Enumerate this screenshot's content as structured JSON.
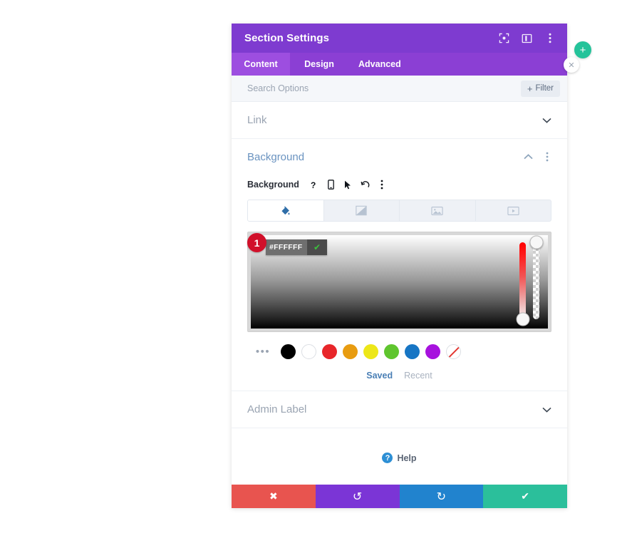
{
  "header": {
    "title": "Section Settings",
    "icons": [
      {
        "name": "fullscreen-icon"
      },
      {
        "name": "layout-columns-icon"
      },
      {
        "name": "more-vertical-icon"
      }
    ]
  },
  "tabs": [
    {
      "label": "Content",
      "active": true
    },
    {
      "label": "Design",
      "active": false
    },
    {
      "label": "Advanced",
      "active": false
    }
  ],
  "search": {
    "placeholder": "Search Options",
    "value": "",
    "filter_label": "Filter",
    "filter_plus": "+"
  },
  "sections": {
    "link": {
      "title": "Link",
      "collapsed": true
    },
    "admin_label": {
      "title": "Admin Label",
      "collapsed": true
    },
    "background": {
      "title": "Background",
      "collapsed": false,
      "field_label": "Background",
      "field_icons": [
        {
          "name": "help-icon",
          "glyph": "?"
        },
        {
          "name": "mobile-icon"
        },
        {
          "name": "cursor-icon"
        },
        {
          "name": "reset-icon"
        },
        {
          "name": "more-vertical-icon"
        }
      ],
      "type_tabs": [
        {
          "name": "background-color-tab",
          "icon": "paint-bucket-icon",
          "active": true
        },
        {
          "name": "background-gradient-tab",
          "icon": "gradient-icon",
          "active": false
        },
        {
          "name": "background-image-tab",
          "icon": "image-icon",
          "active": false
        },
        {
          "name": "background-video-tab",
          "icon": "video-icon",
          "active": false
        }
      ],
      "color_picker": {
        "step_badge": "1",
        "hex_value": "#FFFFFF",
        "confirm_glyph": "✔",
        "hue_handle_position": "bottom",
        "alpha_handle_position": "top"
      },
      "swatches": {
        "more_glyph": "•••",
        "colors": [
          {
            "name": "swatch-black",
            "hex": "#000000"
          },
          {
            "name": "swatch-white",
            "hex": "#FFFFFF"
          },
          {
            "name": "swatch-red",
            "hex": "#E8262A"
          },
          {
            "name": "swatch-orange",
            "hex": "#E89C10"
          },
          {
            "name": "swatch-yellow",
            "hex": "#EDE718"
          },
          {
            "name": "swatch-green",
            "hex": "#5FC52E"
          },
          {
            "name": "swatch-blue",
            "hex": "#1775C4"
          },
          {
            "name": "swatch-purple",
            "hex": "#A712DE"
          },
          {
            "name": "swatch-none",
            "hex": "transparent"
          }
        ]
      },
      "palette_tabs": [
        {
          "label": "Saved",
          "active": true
        },
        {
          "label": "Recent",
          "active": false
        }
      ]
    }
  },
  "help": {
    "label": "Help",
    "glyph": "?"
  },
  "footer": {
    "buttons": [
      {
        "name": "cancel-button",
        "glyph": "✖",
        "color": "#E8544F"
      },
      {
        "name": "undo-button",
        "glyph": "↺",
        "color": "#7B35D6"
      },
      {
        "name": "redo-button",
        "glyph": "↻",
        "color": "#2183CE"
      },
      {
        "name": "save-button",
        "glyph": "✔",
        "color": "#2BBF9B"
      }
    ]
  },
  "floating": {
    "add": {
      "glyph": "+",
      "color": "#24C39A"
    },
    "close": {
      "glyph": "✕"
    }
  },
  "colors": {
    "header_purple": "#7E3BD0",
    "tabbar_purple": "#8B3FD4",
    "tab_active_purple": "#9D4EE0",
    "section_title_blue": "#6A93C0",
    "badge_red": "#D1102A"
  }
}
